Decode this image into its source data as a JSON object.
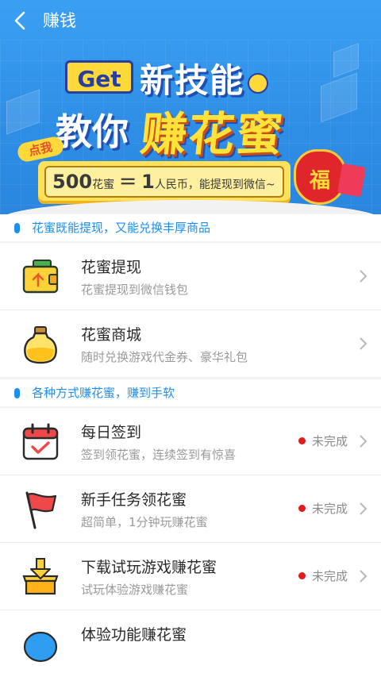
{
  "header": {
    "title": "赚钱"
  },
  "banner": {
    "get": "Get",
    "line1": "新技能",
    "line2a": "教你",
    "line2b": "赚花蜜",
    "click_tag": "点我",
    "rate": {
      "amount": "500",
      "unit": "花蜜",
      "eq": "＝",
      "value": "1",
      "rest": "人民币，能提现到微信~"
    },
    "bag_char": "福"
  },
  "sections": [
    {
      "title": "花蜜既能提现，又能兑换丰厚商品"
    },
    {
      "title": "各种方式赚花蜜，赚到手软"
    }
  ],
  "items_a": [
    {
      "title": "花蜜提现",
      "subtitle": "花蜜提现到微信钱包",
      "icon": "wallet-icon"
    },
    {
      "title": "花蜜商城",
      "subtitle": "随时兑换游戏代金券、豪华礼包",
      "icon": "honey-jar-icon"
    }
  ],
  "items_b": [
    {
      "title": "每日签到",
      "subtitle": "签到领花蜜，连续签到有惊喜",
      "status": "未完成",
      "icon": "calendar-check-icon"
    },
    {
      "title": "新手任务领花蜜",
      "subtitle": "超简单，1分钟玩赚花蜜",
      "status": "未完成",
      "icon": "flag-icon"
    },
    {
      "title": "下载试玩游戏赚花蜜",
      "subtitle": "试玩体验游戏赚花蜜",
      "status": "未完成",
      "icon": "download-box-icon"
    },
    {
      "title": "体验功能赚花蜜",
      "subtitle": "",
      "icon": "experience-icon"
    }
  ],
  "colors": {
    "accent": "#1e8ff0",
    "status_dot": "#e21b1b",
    "hero": "#2f8fe6"
  }
}
